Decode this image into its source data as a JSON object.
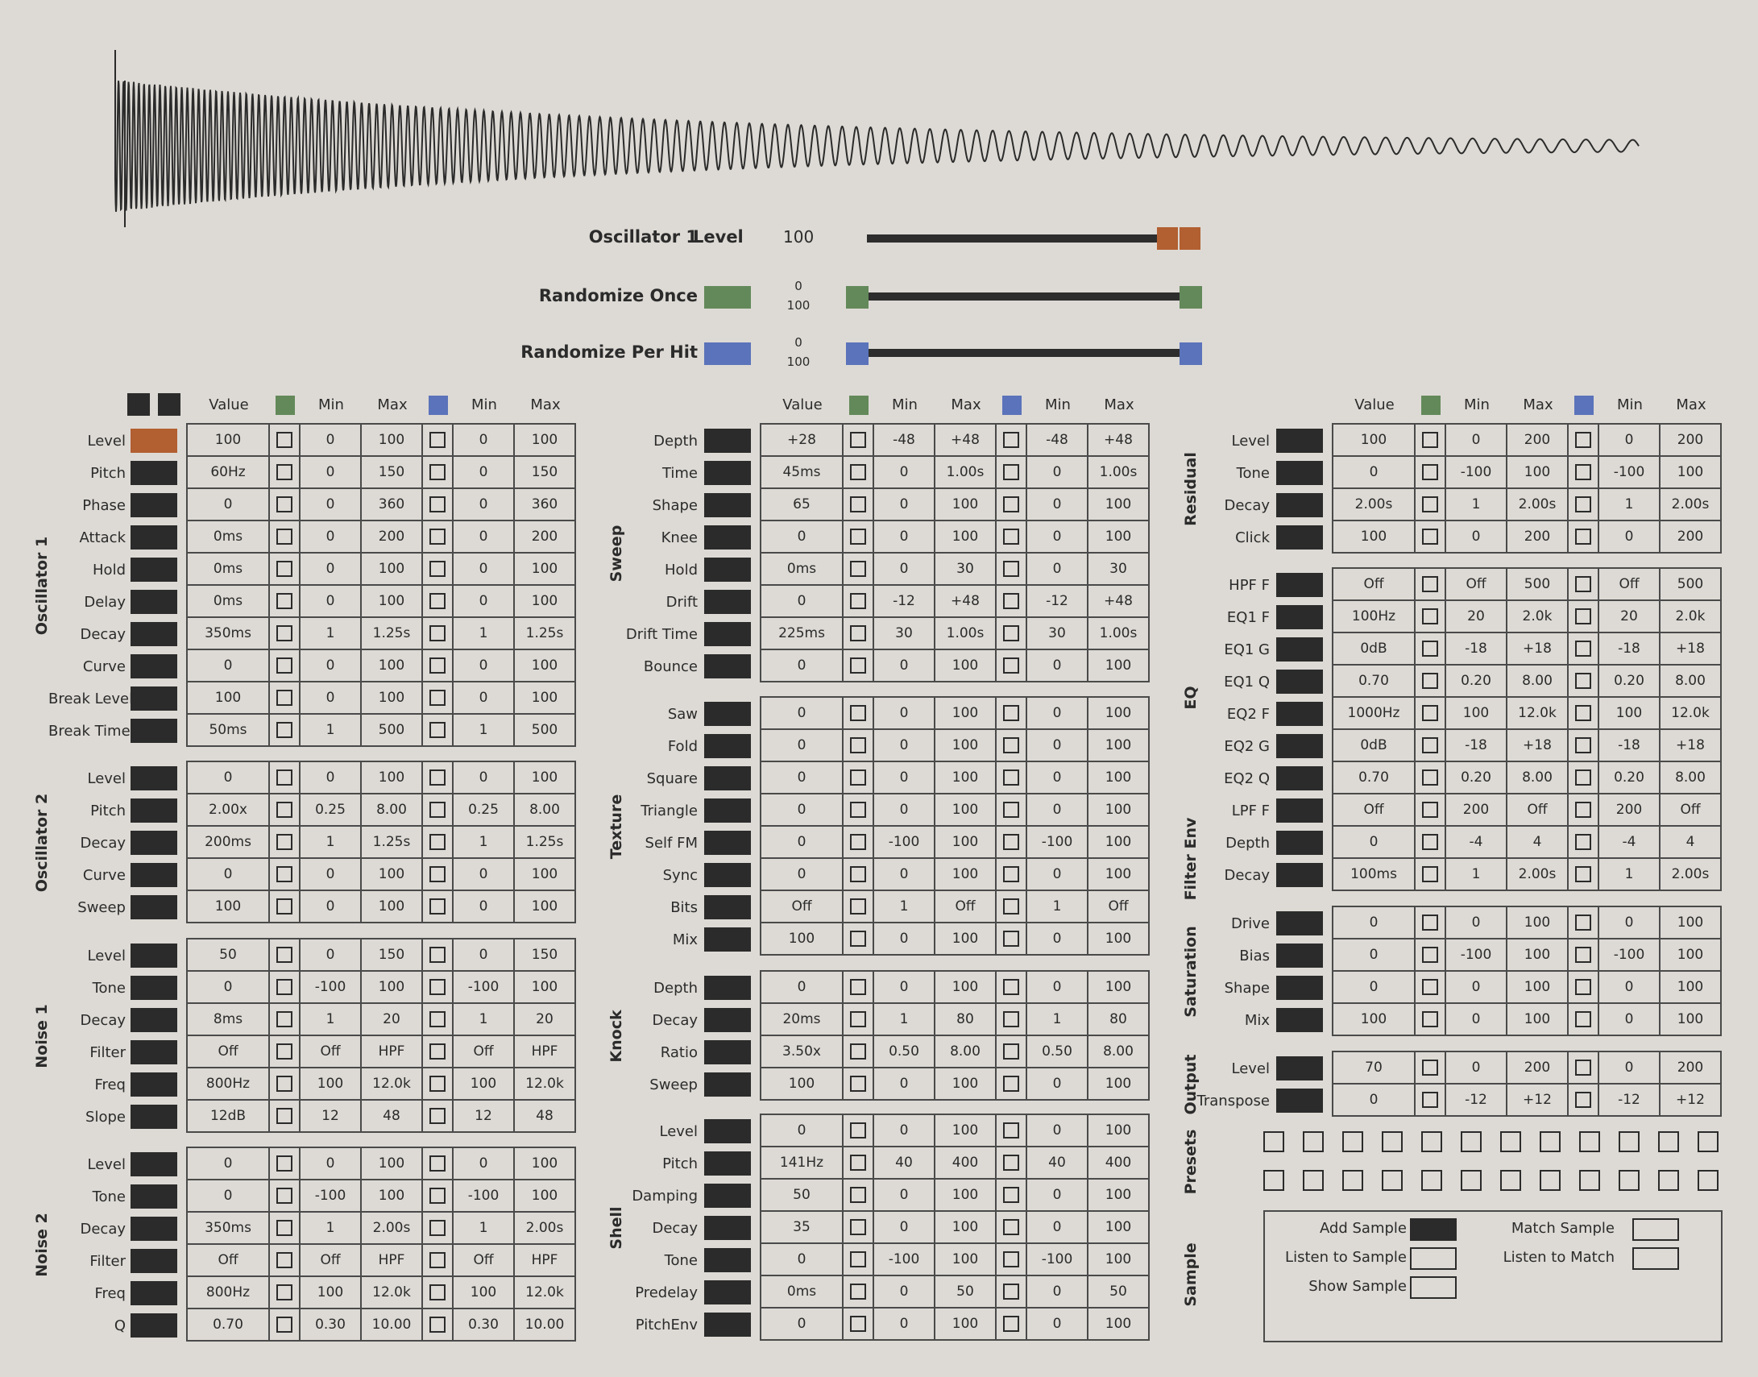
{
  "colors": {
    "background": "#dddad5",
    "ink": "#2b2b2b",
    "accent_orange": "#b25f31",
    "accent_green": "#63895a",
    "accent_blue": "#5b73ba"
  },
  "header": {
    "oscillator_label": "Oscillator 1",
    "param_label": "Level",
    "param_value": "100",
    "level_fraction": 1.0,
    "randomize_once_label": "Randomize Once",
    "randomize_once_min": "0",
    "randomize_once_max": "100",
    "randomize_per_hit_label": "Randomize Per Hit",
    "randomize_per_hit_min": "0",
    "randomize_per_hit_max": "100"
  },
  "columns": [
    "Value",
    "Min",
    "Max",
    "Min",
    "Max"
  ],
  "columns_panel": [
    {
      "groups": [
        {
          "name": "Oscillator 1",
          "rows": [
            [
              "Level",
              "100",
              "0",
              "100",
              "0",
              "100"
            ],
            [
              "Pitch",
              "60Hz",
              "0",
              "150",
              "0",
              "150"
            ],
            [
              "Phase",
              "0",
              "0",
              "360",
              "0",
              "360"
            ],
            [
              "Attack",
              "0ms",
              "0",
              "200",
              "0",
              "200"
            ],
            [
              "Hold",
              "0ms",
              "0",
              "100",
              "0",
              "100"
            ],
            [
              "Delay",
              "0ms",
              "0",
              "100",
              "0",
              "100"
            ],
            [
              "Decay",
              "350ms",
              "1",
              "1.25s",
              "1",
              "1.25s"
            ],
            [
              "Curve",
              "0",
              "0",
              "100",
              "0",
              "100"
            ],
            [
              "Break Level",
              "100",
              "0",
              "100",
              "0",
              "100"
            ],
            [
              "Break Time",
              "50ms",
              "1",
              "500",
              "1",
              "500"
            ]
          ]
        },
        {
          "name": "Oscillator 2",
          "rows": [
            [
              "Level",
              "0",
              "0",
              "100",
              "0",
              "100"
            ],
            [
              "Pitch",
              "2.00x",
              "0.25",
              "8.00",
              "0.25",
              "8.00"
            ],
            [
              "Decay",
              "200ms",
              "1",
              "1.25s",
              "1",
              "1.25s"
            ],
            [
              "Curve",
              "0",
              "0",
              "100",
              "0",
              "100"
            ],
            [
              "Sweep",
              "100",
              "0",
              "100",
              "0",
              "100"
            ]
          ]
        },
        {
          "name": "Noise 1",
          "rows": [
            [
              "Level",
              "50",
              "0",
              "150",
              "0",
              "150"
            ],
            [
              "Tone",
              "0",
              "-100",
              "100",
              "-100",
              "100"
            ],
            [
              "Decay",
              "8ms",
              "1",
              "20",
              "1",
              "20"
            ],
            [
              "Filter",
              "Off",
              "Off",
              "HPF",
              "Off",
              "HPF"
            ],
            [
              "Freq",
              "800Hz",
              "100",
              "12.0k",
              "100",
              "12.0k"
            ],
            [
              "Slope",
              "12dB",
              "12",
              "48",
              "12",
              "48"
            ]
          ]
        },
        {
          "name": "Noise 2",
          "rows": [
            [
              "Level",
              "0",
              "0",
              "100",
              "0",
              "100"
            ],
            [
              "Tone",
              "0",
              "-100",
              "100",
              "-100",
              "100"
            ],
            [
              "Decay",
              "350ms",
              "1",
              "2.00s",
              "1",
              "2.00s"
            ],
            [
              "Filter",
              "Off",
              "Off",
              "HPF",
              "Off",
              "HPF"
            ],
            [
              "Freq",
              "800Hz",
              "100",
              "12.0k",
              "100",
              "12.0k"
            ],
            [
              "Q",
              "0.70",
              "0.30",
              "10.00",
              "0.30",
              "10.00"
            ]
          ]
        }
      ]
    },
    {
      "groups": [
        {
          "name": "Sweep",
          "rows": [
            [
              "Depth",
              "+28",
              "-48",
              "+48",
              "-48",
              "+48"
            ],
            [
              "Time",
              "45ms",
              "0",
              "1.00s",
              "0",
              "1.00s"
            ],
            [
              "Shape",
              "65",
              "0",
              "100",
              "0",
              "100"
            ],
            [
              "Knee",
              "0",
              "0",
              "100",
              "0",
              "100"
            ],
            [
              "Hold",
              "0ms",
              "0",
              "30",
              "0",
              "30"
            ],
            [
              "Drift",
              "0",
              "-12",
              "+48",
              "-12",
              "+48"
            ],
            [
              "Drift Time",
              "225ms",
              "30",
              "1.00s",
              "30",
              "1.00s"
            ],
            [
              "Bounce",
              "0",
              "0",
              "100",
              "0",
              "100"
            ]
          ]
        },
        {
          "name": "Texture",
          "rows": [
            [
              "Saw",
              "0",
              "0",
              "100",
              "0",
              "100"
            ],
            [
              "Fold",
              "0",
              "0",
              "100",
              "0",
              "100"
            ],
            [
              "Square",
              "0",
              "0",
              "100",
              "0",
              "100"
            ],
            [
              "Triangle",
              "0",
              "0",
              "100",
              "0",
              "100"
            ],
            [
              "Self FM",
              "0",
              "-100",
              "100",
              "-100",
              "100"
            ],
            [
              "Sync",
              "0",
              "0",
              "100",
              "0",
              "100"
            ],
            [
              "Bits",
              "Off",
              "1",
              "Off",
              "1",
              "Off"
            ],
            [
              "Mix",
              "100",
              "0",
              "100",
              "0",
              "100"
            ]
          ]
        },
        {
          "name": "Knock",
          "rows": [
            [
              "Depth",
              "0",
              "0",
              "100",
              "0",
              "100"
            ],
            [
              "Decay",
              "20ms",
              "1",
              "80",
              "1",
              "80"
            ],
            [
              "Ratio",
              "3.50x",
              "0.50",
              "8.00",
              "0.50",
              "8.00"
            ],
            [
              "Sweep",
              "100",
              "0",
              "100",
              "0",
              "100"
            ]
          ]
        },
        {
          "name": "Shell",
          "rows": [
            [
              "Level",
              "0",
              "0",
              "100",
              "0",
              "100"
            ],
            [
              "Pitch",
              "141Hz",
              "40",
              "400",
              "40",
              "400"
            ],
            [
              "Damping",
              "50",
              "0",
              "100",
              "0",
              "100"
            ],
            [
              "Decay",
              "35",
              "0",
              "100",
              "0",
              "100"
            ],
            [
              "Tone",
              "0",
              "-100",
              "100",
              "-100",
              "100"
            ],
            [
              "Predelay",
              "0ms",
              "0",
              "50",
              "0",
              "50"
            ],
            [
              "PitchEnv",
              "0",
              "0",
              "100",
              "0",
              "100"
            ]
          ]
        }
      ]
    },
    {
      "groups": [
        {
          "name": "Residual",
          "rows": [
            [
              "Level",
              "100",
              "0",
              "200",
              "0",
              "200"
            ],
            [
              "Tone",
              "0",
              "-100",
              "100",
              "-100",
              "100"
            ],
            [
              "Decay",
              "2.00s",
              "1",
              "2.00s",
              "1",
              "2.00s"
            ],
            [
              "Click",
              "100",
              "0",
              "200",
              "0",
              "200"
            ]
          ]
        },
        {
          "name": "EQ",
          "rows": [
            [
              "HPF F",
              "Off",
              "Off",
              "500",
              "Off",
              "500"
            ],
            [
              "EQ1 F",
              "100Hz",
              "20",
              "2.0k",
              "20",
              "2.0k"
            ],
            [
              "EQ1 G",
              "0dB",
              "-18",
              "+18",
              "-18",
              "+18"
            ],
            [
              "EQ1 Q",
              "0.70",
              "0.20",
              "8.00",
              "0.20",
              "8.00"
            ],
            [
              "EQ2 F",
              "1000Hz",
              "100",
              "12.0k",
              "100",
              "12.0k"
            ],
            [
              "EQ2 G",
              "0dB",
              "-18",
              "+18",
              "-18",
              "+18"
            ],
            [
              "EQ2 Q",
              "0.70",
              "0.20",
              "8.00",
              "0.20",
              "8.00"
            ],
            [
              "LPF F",
              "Off",
              "200",
              "Off",
              "200",
              "Off"
            ],
            [
              "Depth",
              "0",
              "-4",
              "4",
              "-4",
              "4"
            ],
            [
              "Decay",
              "100ms",
              "1",
              "2.00s",
              "1",
              "2.00s"
            ]
          ],
          "subsections": [
            {
              "name": "EQ",
              "span": [
                0,
                7
              ]
            },
            {
              "name": "Filter Env",
              "span": [
                8,
                9
              ]
            }
          ]
        },
        {
          "name": "Saturation",
          "rows": [
            [
              "Drive",
              "0",
              "0",
              "100",
              "0",
              "100"
            ],
            [
              "Bias",
              "0",
              "-100",
              "100",
              "-100",
              "100"
            ],
            [
              "Shape",
              "0",
              "0",
              "100",
              "0",
              "100"
            ],
            [
              "Mix",
              "100",
              "0",
              "100",
              "0",
              "100"
            ]
          ]
        },
        {
          "name": "Output",
          "rows": [
            [
              "Level",
              "70",
              "0",
              "200",
              "0",
              "200"
            ],
            [
              "Transpose",
              "0",
              "-12",
              "+12",
              "-12",
              "+12"
            ]
          ]
        }
      ]
    }
  ],
  "presets_label": "Presets",
  "sample": {
    "section_label": "Sample",
    "add_sample": "Add Sample",
    "listen_to_sample": "Listen to Sample",
    "show_sample": "Show Sample",
    "match_sample": "Match Sample",
    "listen_to_match": "Listen to Match"
  }
}
